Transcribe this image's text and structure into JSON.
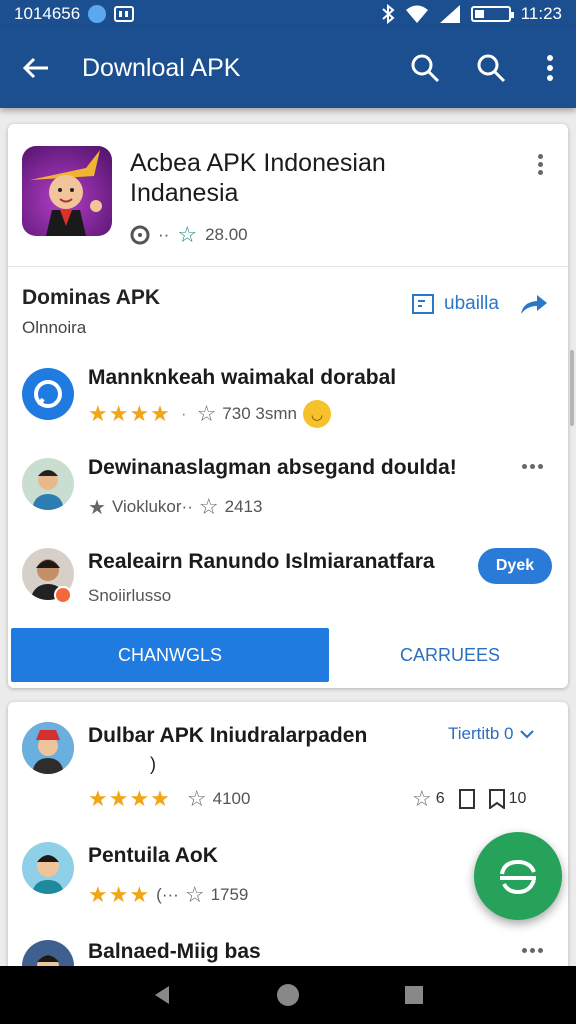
{
  "status_bar": {
    "time_left": "1014656",
    "time_right": "11:23",
    "battery_level": 0.3
  },
  "app_bar": {
    "title": "Downloal APK",
    "back_icon": "arrow-left-icon",
    "search_icon": "search-icon",
    "menu_icon": "more-vert-icon"
  },
  "hero": {
    "title_line1": "Acbea APK Indonesian",
    "title_line2": "Indanesia",
    "meta_dots": "··",
    "rating": "28.00"
  },
  "section": {
    "title": "Dominas APK",
    "subtitle": "Olnnoira",
    "link_label": "ubailla"
  },
  "list1": [
    {
      "title": "Mannknkeah waimakal dorabal",
      "stars": "★★★★",
      "count": "730 3smn"
    },
    {
      "title": "Dewinanaslagman absegand doulda!",
      "rating_text": "Vioklukor··",
      "count": "2413"
    },
    {
      "title": "Realeairn Ranundo Islmiaranatfara",
      "subtitle": "Snoiirlusso",
      "pill": "Dyek"
    }
  ],
  "buttons": {
    "primary": "CHANWGLS",
    "secondary": "CARRUEES"
  },
  "card2": {
    "trend_label": "Tiertitb 0",
    "items": [
      {
        "title": "Dulbar APK Iniudralarpaden",
        "subtitle": ")",
        "stars": "★★★★",
        "count": "4100",
        "a": "6",
        "b": "10"
      },
      {
        "title": "Pentuila AoK",
        "stars": "★★★",
        "extra": "(···",
        "count": "1759"
      },
      {
        "title": "Balnaed-Miig bas"
      }
    ]
  },
  "colors": {
    "primary": "#1c4f8f",
    "accent": "#1f7be0",
    "star": "#f2a516",
    "fab": "#26a25a"
  }
}
